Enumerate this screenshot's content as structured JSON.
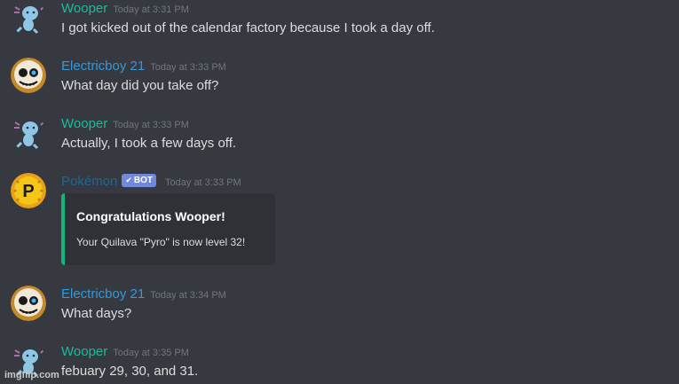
{
  "colors": {
    "background": "#36393f",
    "wooper_name": "#1abc9c",
    "electricboy_name": "#3498db",
    "pokemon_name": "#206694",
    "bot_badge": "#7289da",
    "embed_border": "#0fb87f",
    "embed_bg": "#2f3136"
  },
  "messages": [
    {
      "author": "Wooper",
      "timestamp": "Today at 3:31 PM",
      "text": "I got kicked out of the calendar factory because I took a day off.",
      "avatar": "wooper-avatar"
    },
    {
      "author": "Electricboy 21",
      "timestamp": "Today at 3:33 PM",
      "text": "What day did you take off?",
      "avatar": "skull-avatar"
    },
    {
      "author": "Wooper",
      "timestamp": "Today at 3:33 PM",
      "text": "Actually, I took a few days off.",
      "avatar": "wooper-avatar"
    },
    {
      "author": "Pokémon",
      "badge": "BOT",
      "badge_icon": "checkmark-icon",
      "timestamp": "Today at 3:33 PM",
      "avatar": "pokeball-avatar",
      "embed": {
        "title": "Congratulations Wooper!",
        "description": "Your Quilava \"Pyro\" is now level 32!"
      }
    },
    {
      "author": "Electricboy 21",
      "timestamp": "Today at 3:34 PM",
      "text": "What days?",
      "avatar": "skull-avatar"
    },
    {
      "author": "Wooper",
      "timestamp": "Today at 3:35 PM",
      "text": "febuary 29, 30, and 31.",
      "avatar": "wooper-avatar"
    }
  ],
  "watermark": "imgflip.com"
}
